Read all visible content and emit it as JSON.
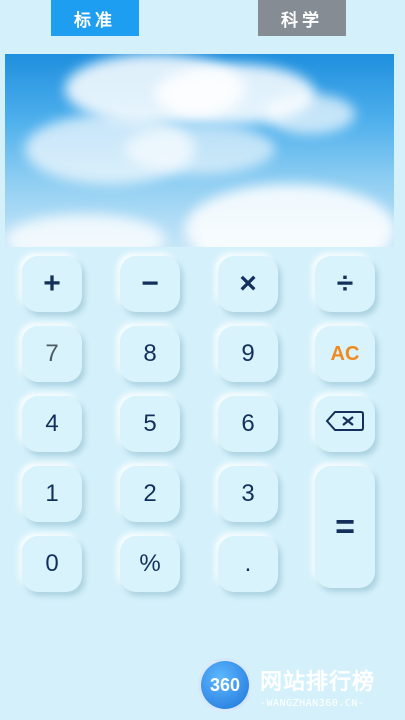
{
  "tabs": {
    "standard": "标准",
    "scientific": "科学"
  },
  "keys": {
    "add": "+",
    "subtract": "−",
    "multiply": "×",
    "divide": "÷",
    "seven": "7",
    "eight": "8",
    "nine": "9",
    "clear": "AC",
    "four": "4",
    "five": "5",
    "six": "6",
    "one": "1",
    "two": "2",
    "three": "3",
    "equals": "=",
    "zero": "0",
    "percent": "%",
    "decimal": "."
  },
  "icons": {
    "backspace": "backspace-icon"
  },
  "watermark": {
    "logo": "360",
    "title": "网站排行榜",
    "url": "-WANGZHAN360.CN-"
  },
  "colors": {
    "tab_active": "#1d9ef0",
    "tab_inactive": "#858c93",
    "clear_key": "#ef8a1e",
    "key_text": "#13305c"
  }
}
